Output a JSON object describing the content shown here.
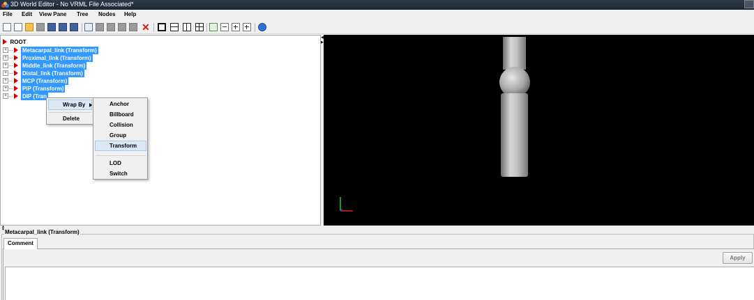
{
  "window": {
    "title": "3D World Editor - No VRML File Associated*"
  },
  "menu": [
    "File",
    "Edit",
    "View Pane",
    "Tree",
    "Nodes",
    "Help"
  ],
  "tree": {
    "root_label": "ROOT",
    "nodes": [
      "Metacarpal_link (Transform)",
      "Proximal_link (Transform)",
      "Middle_link (Transform)",
      "Distal_link (Transform)",
      "MCP (Transform)",
      "PIP (Transform)",
      "DIP (Tran"
    ],
    "expander_glyph": "+"
  },
  "context_menu": {
    "wrap_by": "Wrap By",
    "delete": "Delete",
    "submenu": [
      "Anchor",
      "Billboard",
      "Collision",
      "Group",
      "Transform",
      "LOD",
      "Switch"
    ],
    "highlighted": "Transform"
  },
  "properties": {
    "title": "Metacarpal_link (Transform)",
    "tab": "Comment",
    "apply": "Apply"
  },
  "colors": {
    "selection": "#3399ff",
    "node_marker": "#d40000",
    "viewport_bg": "#000000"
  }
}
